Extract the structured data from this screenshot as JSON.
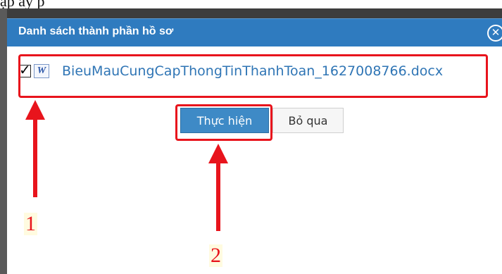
{
  "document": {
    "top_text": "ập                     ây          p"
  },
  "dialog": {
    "title": "Danh sách thành phần hồ sơ",
    "close_symbol": "✕",
    "header_color": "#2f7bbf"
  },
  "file": {
    "checked": true,
    "icon": "word-document-icon",
    "icon_letter": "W",
    "name": "BieuMauCungCapThongTinThanhToan_1627008766.docx"
  },
  "buttons": {
    "confirm_label": "Thực hiện",
    "skip_label": "Bỏ qua"
  },
  "annotations": {
    "color": "#e8141c",
    "label_1": "1",
    "label_2": "2"
  }
}
